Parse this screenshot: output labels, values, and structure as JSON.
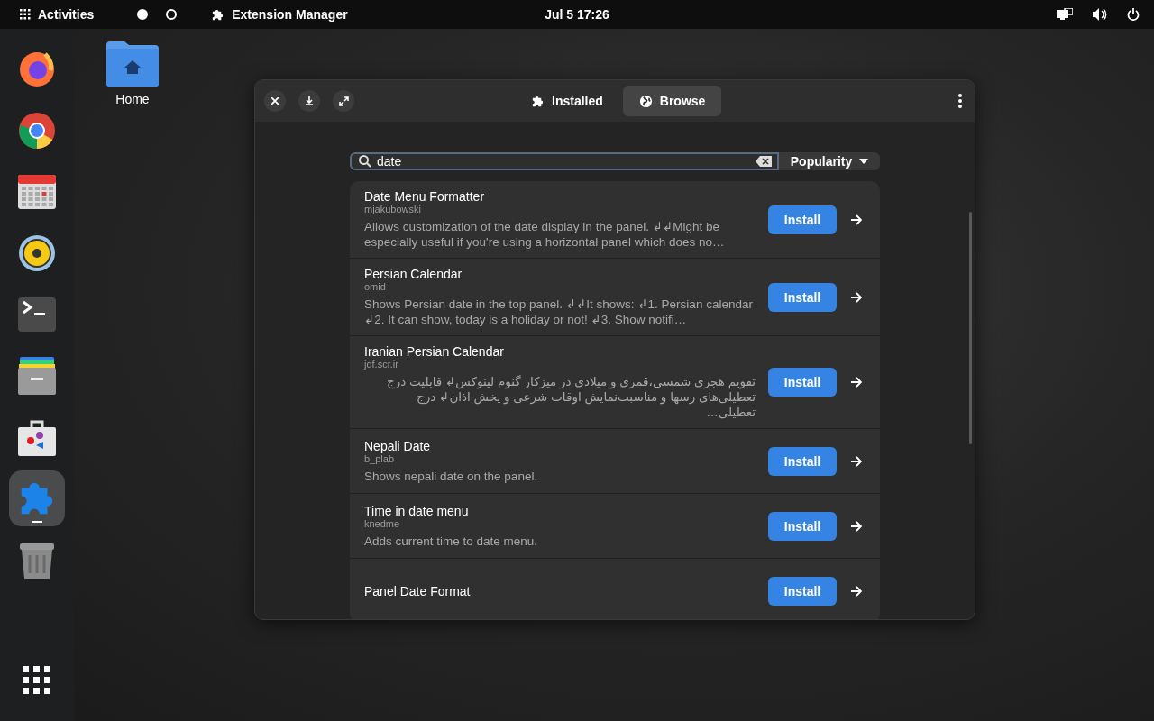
{
  "top_bar": {
    "activities": "Activities",
    "workspaces": [
      {
        "selected": true
      },
      {
        "selected": false
      }
    ],
    "app_menu": "Extension Manager",
    "clock": "Jul 5  17:26"
  },
  "dock": {
    "apps": [
      {
        "kind": "firefox",
        "running": false
      },
      {
        "kind": "chrome",
        "running": false
      },
      {
        "kind": "calendar",
        "running": false
      },
      {
        "kind": "speaker",
        "running": false
      },
      {
        "kind": "terminal",
        "running": false
      },
      {
        "kind": "cabinet",
        "running": false
      },
      {
        "kind": "store",
        "running": false
      },
      {
        "kind": "puzzle",
        "running": true
      },
      {
        "kind": "trash",
        "running": false
      }
    ]
  },
  "desktop": {
    "icons": [
      {
        "label": "Home"
      }
    ]
  },
  "window": {
    "tabs": [
      {
        "label": "Installed",
        "kind": "puzzle",
        "selected": false
      },
      {
        "label": "Browse",
        "kind": "globe",
        "selected": true
      }
    ],
    "search": {
      "value": "date"
    },
    "sort": {
      "label": "Popularity"
    },
    "extensions": [
      {
        "name": "Date Menu Formatter",
        "author": "mjakubowski",
        "description": "Allows customization of the date display in the panel. ↲↲Might be especially useful if you're using a horizontal panel which does no…",
        "rtl": false,
        "action": "Install"
      },
      {
        "name": "Persian Calendar",
        "author": "omid",
        "description": "Shows Persian date in the top panel. ↲↲It shows: ↲1. Persian calendar ↲2. It can show, today is a holiday or not! ↲3. Show notifi…",
        "rtl": false,
        "action": "Install"
      },
      {
        "name": "Iranian Persian Calendar",
        "author": "jdf.scr.ir",
        "description": "تقویم هجری شمسی،قمری و میلادی در میزکار گنوم لینوکس↲ قابلیت درج تعطیلی‌های رسها و مناسبت‌نمایش اوقات شرعی و پخش اذان↲ درج تعطیلی…",
        "rtl": true,
        "action": "Install"
      },
      {
        "name": "Nepali Date",
        "author": "b_plab",
        "description": "Shows nepali date on the panel.",
        "rtl": false,
        "action": "Install"
      },
      {
        "name": "Time in date menu",
        "author": "knedme",
        "description": "Adds current time to date menu.",
        "rtl": false,
        "action": "Install"
      },
      {
        "name": "Panel Date Format",
        "action": "Install"
      }
    ]
  }
}
